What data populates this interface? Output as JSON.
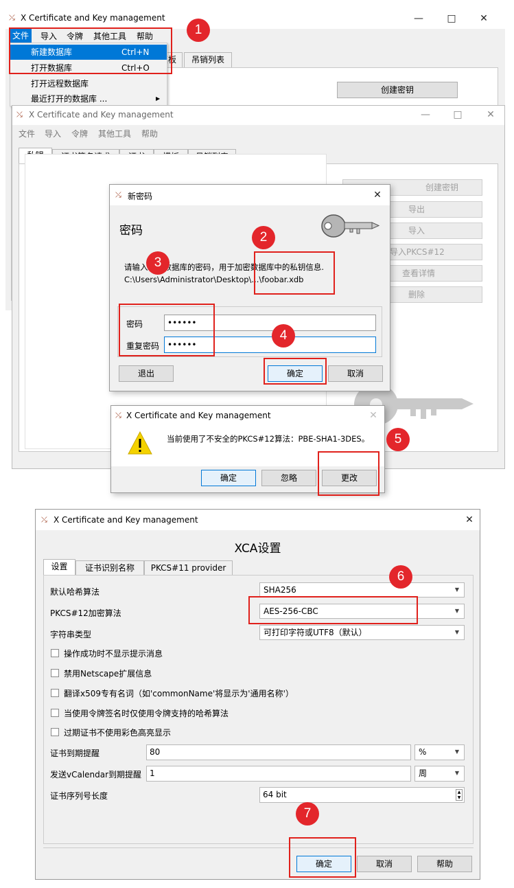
{
  "app_title": "X Certificate and Key management",
  "main_window": {
    "menu": [
      "文件",
      "导入",
      "令牌",
      "其他工具",
      "帮助"
    ],
    "tabs_partial": [
      "模板",
      "吊销列表"
    ],
    "file_menu_items": [
      {
        "label": "新建数据库",
        "shortcut": "Ctrl+N"
      },
      {
        "label": "打开数据库",
        "shortcut": "Ctrl+O"
      },
      {
        "label": "打开远程数据库",
        "shortcut": ""
      },
      {
        "label": "最近打开的数据库 ...",
        "shortcut": ""
      }
    ],
    "create_key_button": "创建密钥"
  },
  "second_window": {
    "tabs": [
      "私钥",
      "证书签名请求",
      "证书",
      "模板",
      "吊销列表"
    ],
    "side_buttons": [
      "创建密钥",
      "导出",
      "导入",
      "导入PKCS#12",
      "查看详情",
      "删除"
    ]
  },
  "password_dialog": {
    "title": "新密码",
    "heading": "密码",
    "message_line1": "请输入XCA数据库的密码，用于加密数据库中的私钥信息.",
    "message_line2": "C:\\Users\\Administrator\\Desktop\\...\\foobar.xdb",
    "password_label": "密码",
    "password_value": "••••••",
    "repeat_label": "重复密码",
    "repeat_value": "••••••",
    "exit_button": "退出",
    "ok_button": "确定",
    "cancel_button": "取消"
  },
  "warning_dialog": {
    "title": "X Certificate and Key management",
    "message": "当前使用了不安全的PKCS#12算法：PBE-SHA1-3DES。",
    "ok_button": "确定",
    "ignore_button": "忽略",
    "change_button": "更改"
  },
  "settings_dialog": {
    "title": "X Certificate and Key management",
    "heading": "XCA设置",
    "tabs": [
      "设置",
      "证书识别名称",
      "PKCS#11 provider"
    ],
    "rows": [
      {
        "label": "默认哈希算法",
        "value": "SHA256"
      },
      {
        "label": "PKCS#12加密算法",
        "value": "AES-256-CBC"
      },
      {
        "label": "字符串类型",
        "value": "可打印字符或UTF8（默认）"
      }
    ],
    "checkboxes": [
      "操作成功时不显示提示消息",
      "禁用Netscape扩展信息",
      "翻译x509专有名词（如'commonName'将显示为'通用名称'）",
      "当使用令牌签名时仅使用令牌支持的哈希算法",
      "过期证书不使用彩色高亮显示"
    ],
    "expiry_label": "证书到期提醒",
    "expiry_value": "80",
    "expiry_unit": "%",
    "vcal_label": "发送vCalendar到期提醒",
    "vcal_value": "1",
    "vcal_unit": "周",
    "serial_label": "证书序列号长度",
    "serial_value": "64 bit",
    "ok_button": "确定",
    "cancel_button": "取消",
    "help_button": "帮助"
  },
  "badges": [
    "1",
    "2",
    "3",
    "4",
    "5",
    "6",
    "7"
  ],
  "colors": {
    "annotation_red": "#e0201b",
    "badge_red": "#e3262b",
    "selection_blue": "#0078d7"
  }
}
